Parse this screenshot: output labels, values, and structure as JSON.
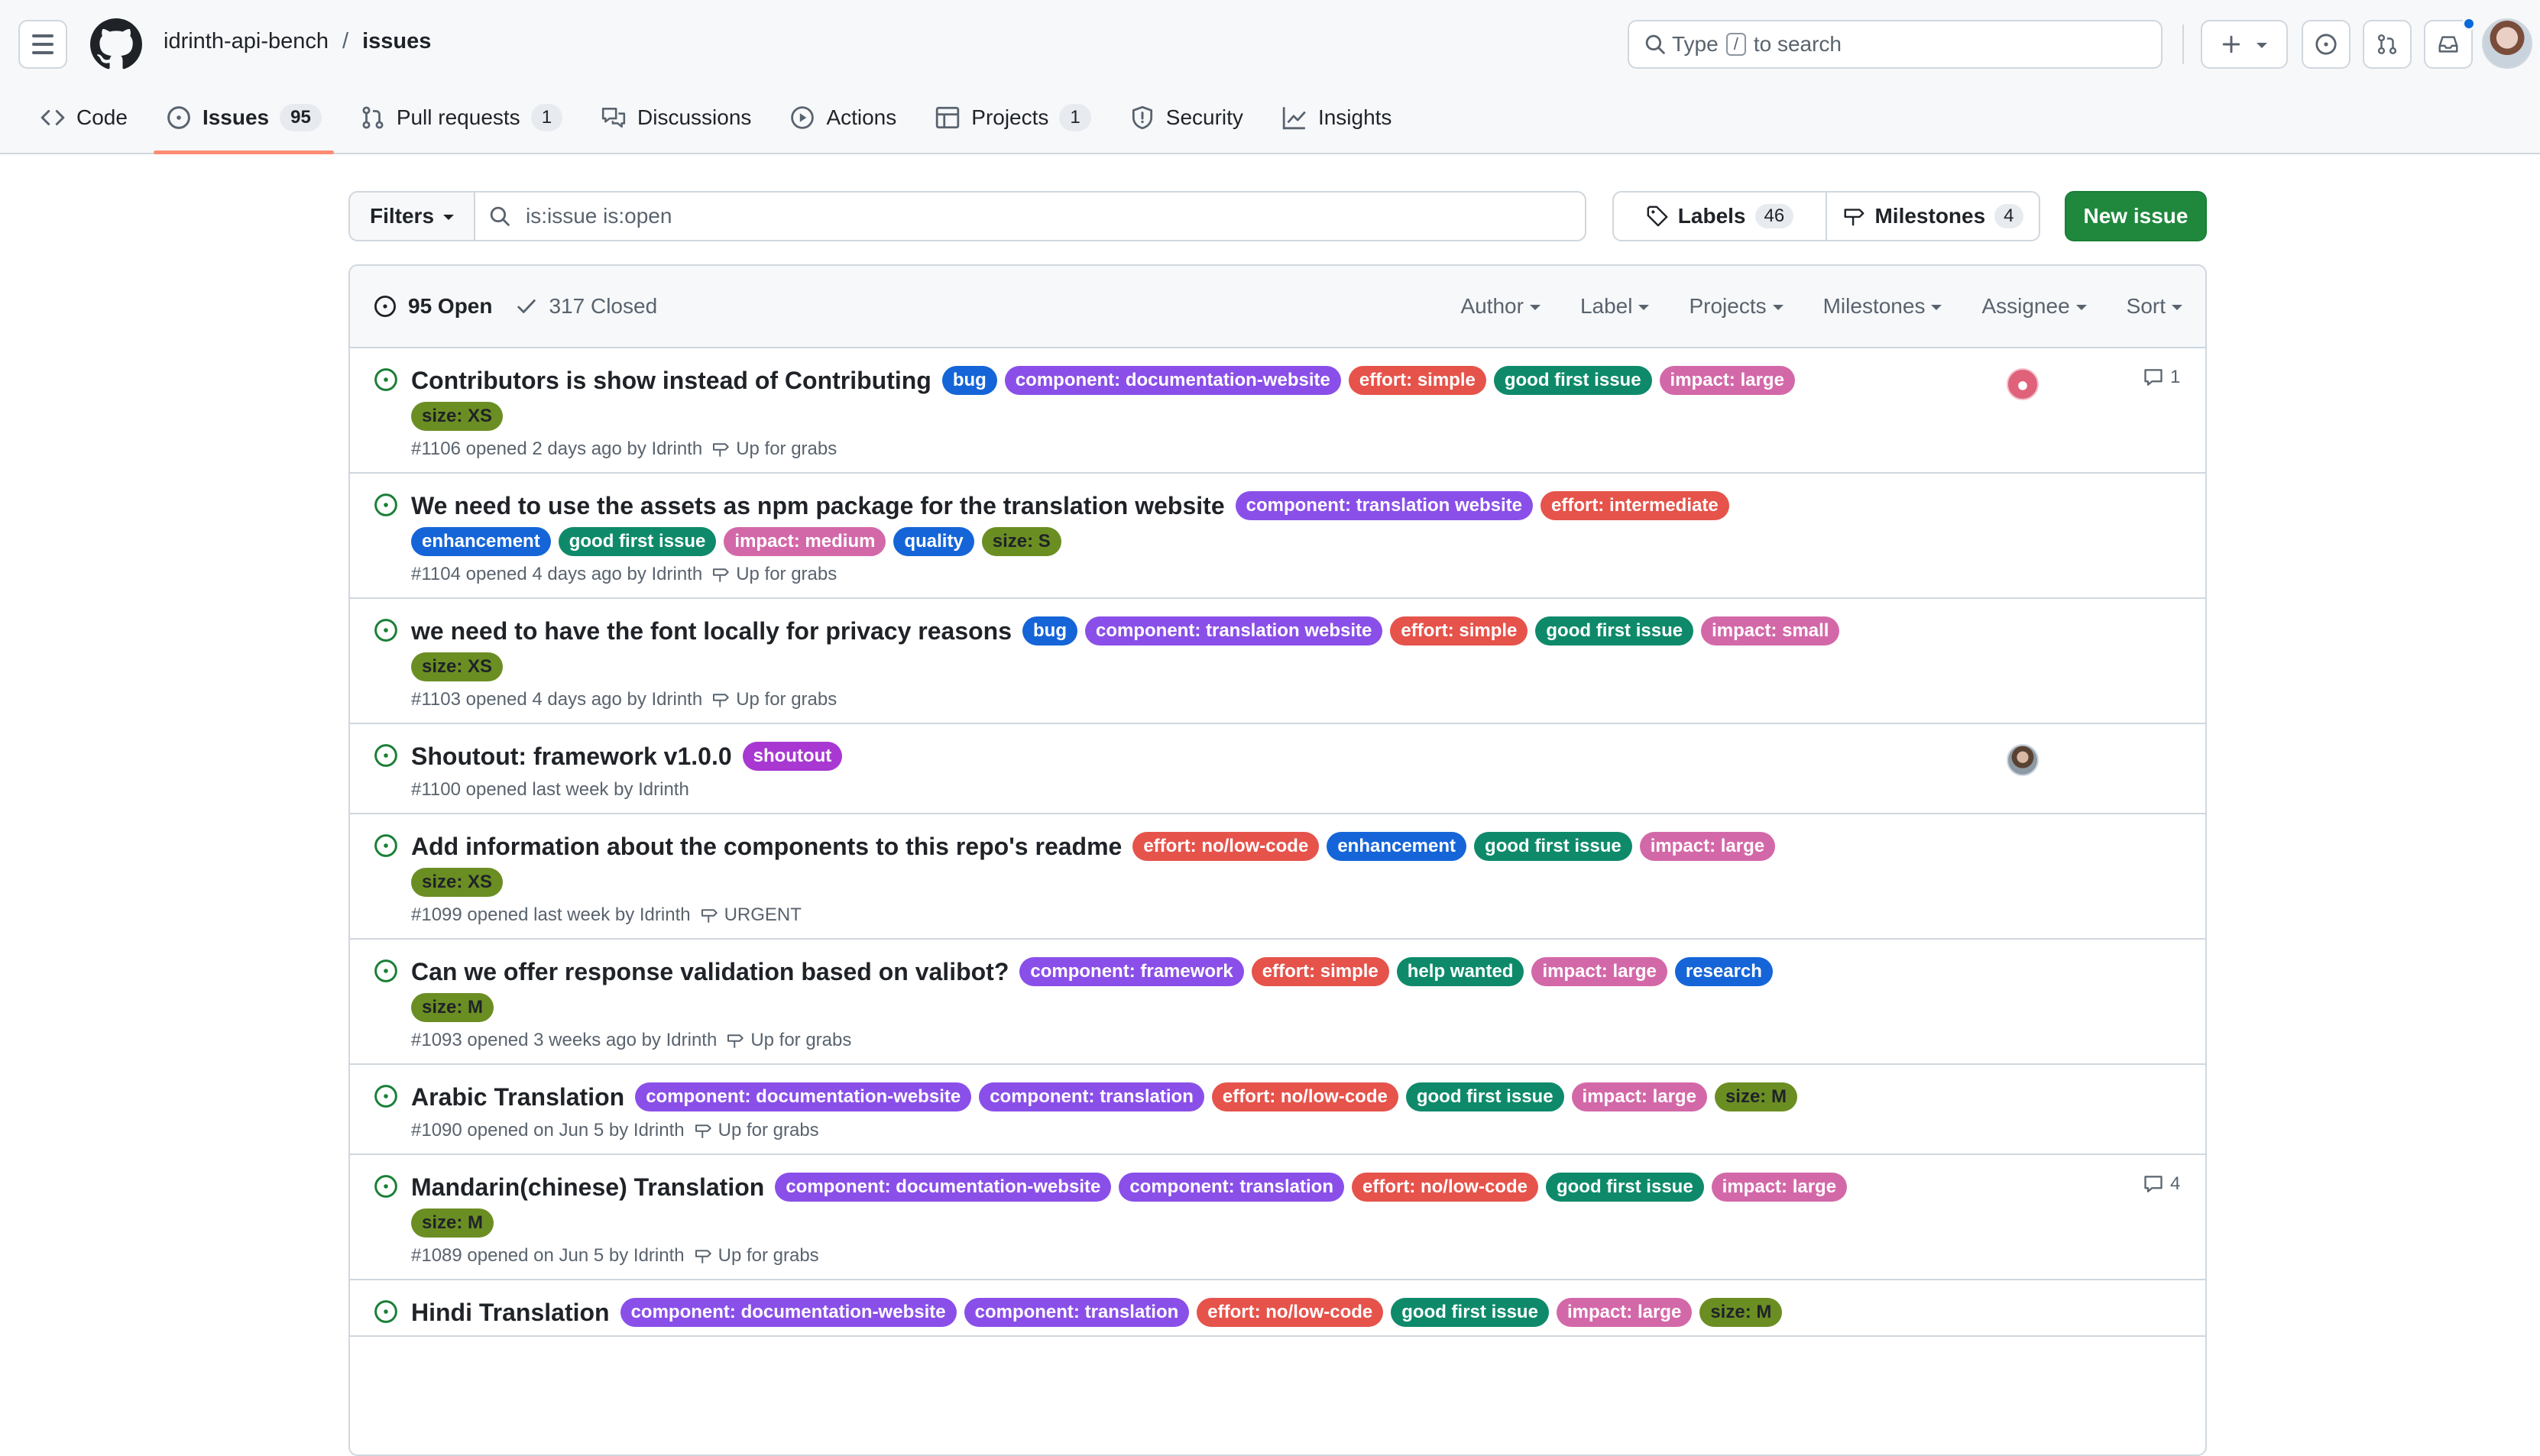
{
  "header": {
    "owner": "idrinth-api-bench",
    "separator": "/",
    "repo": "issues",
    "search": {
      "before": "Type",
      "key": "/",
      "after": "to search"
    }
  },
  "tabs": [
    {
      "label": "Code",
      "icon": "code-icon"
    },
    {
      "label": "Issues",
      "count": "95",
      "icon": "issue-opened-icon",
      "active": true
    },
    {
      "label": "Pull requests",
      "count": "1",
      "icon": "git-pull-request-icon"
    },
    {
      "label": "Discussions",
      "icon": "comment-discussion-icon"
    },
    {
      "label": "Actions",
      "icon": "play-icon"
    },
    {
      "label": "Projects",
      "count": "1",
      "icon": "table-icon"
    },
    {
      "label": "Security",
      "icon": "shield-icon"
    },
    {
      "label": "Insights",
      "icon": "graph-icon"
    }
  ],
  "toolbar": {
    "filters_label": "Filters",
    "query": "is:issue is:open",
    "labels_label": "Labels",
    "labels_count": "46",
    "milestones_label": "Milestones",
    "milestones_count": "4",
    "new_issue_label": "New issue"
  },
  "list_header": {
    "open": "95 Open",
    "closed": "317 Closed",
    "sorts": [
      "Author",
      "Label",
      "Projects",
      "Milestones",
      "Assignee",
      "Sort"
    ]
  },
  "label_colors": {
    "bug": "#1565d8",
    "enhancement": "#1565d8",
    "quality": "#1565d8",
    "research": "#1565d8",
    "component": "#8a4fe8",
    "effort": "#e5534b",
    "good first issue": "#0e8a6a",
    "help wanted": "#0e8a6a",
    "impact": "#d368a8",
    "size": "#6b8e23",
    "shoutout": "#a838d1"
  },
  "issues": [
    {
      "title": "Contributors is show instead of Contributing",
      "labels": [
        "bug",
        "component: documentation-website",
        "effort: simple",
        "good first issue",
        "impact: large",
        "size: XS"
      ],
      "meta": "#1106 opened 2 days ago by Idrinth",
      "milestone": "Up for grabs",
      "assignee": "pink",
      "comments": "1"
    },
    {
      "title": "We need to use the assets as npm package for the translation website",
      "labels": [
        "component: translation website",
        "effort: intermediate",
        "enhancement",
        "good first issue",
        "impact: medium",
        "quality",
        "size: S"
      ],
      "meta": "#1104 opened 4 days ago by Idrinth",
      "milestone": "Up for grabs"
    },
    {
      "title": "we need to have the font locally for privacy reasons",
      "labels": [
        "bug",
        "component: translation website",
        "effort: simple",
        "good first issue",
        "impact: small",
        "size: XS"
      ],
      "meta": "#1103 opened 4 days ago by Idrinth",
      "milestone": "Up for grabs"
    },
    {
      "title": "Shoutout: framework v1.0.0",
      "labels": [
        "shoutout"
      ],
      "meta": "#1100 opened last week by Idrinth",
      "assignee": "photo"
    },
    {
      "title": "Add information about the components to this repo's readme",
      "labels": [
        "effort: no/low-code",
        "enhancement",
        "good first issue",
        "impact: large",
        "size: XS"
      ],
      "meta": "#1099 opened last week by Idrinth",
      "milestone": "URGENT"
    },
    {
      "title": "Can we offer response validation based on valibot?",
      "labels": [
        "component: framework",
        "effort: simple",
        "help wanted",
        "impact: large",
        "research",
        "size: M"
      ],
      "meta": "#1093 opened 3 weeks ago by Idrinth",
      "milestone": "Up for grabs"
    },
    {
      "title": "Arabic Translation",
      "labels": [
        "component: documentation-website",
        "component: translation",
        "effort: no/low-code",
        "good first issue",
        "impact: large",
        "size: M"
      ],
      "meta": "#1090 opened on Jun 5 by Idrinth",
      "milestone": "Up for grabs"
    },
    {
      "title": "Mandarin(chinese) Translation",
      "labels": [
        "component: documentation-website",
        "component: translation",
        "effort: no/low-code",
        "good first issue",
        "impact: large",
        "size: M"
      ],
      "meta": "#1089 opened on Jun 5 by Idrinth",
      "milestone": "Up for grabs",
      "comments": "4"
    },
    {
      "title": "Hindi Translation",
      "labels": [
        "component: documentation-website",
        "component: translation",
        "effort: no/low-code",
        "good first issue",
        "impact: large",
        "size: M"
      ],
      "meta": "",
      "milestone": ""
    }
  ]
}
